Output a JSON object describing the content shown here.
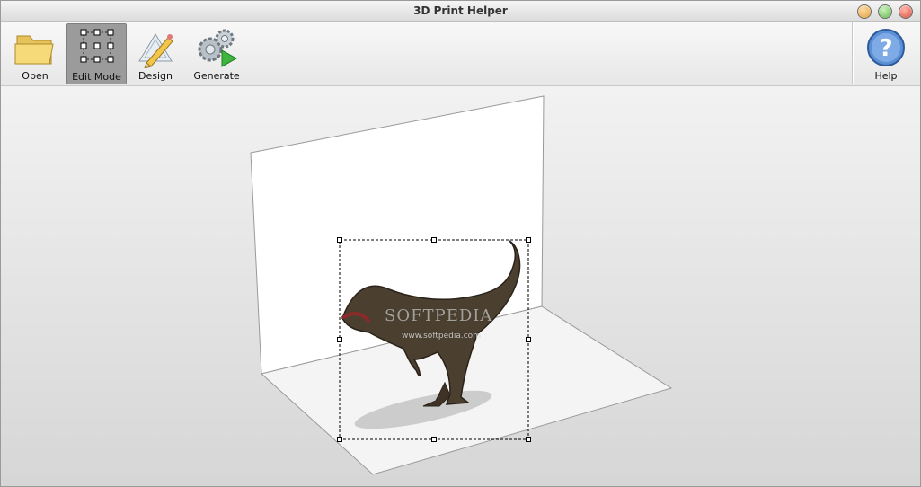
{
  "window": {
    "title": "3D Print Helper",
    "controls": [
      "minimize",
      "maximize",
      "close"
    ]
  },
  "toolbar": {
    "open_label": "Open",
    "edit_mode_label": "Edit Mode",
    "design_label": "Design",
    "generate_label": "Generate",
    "help_label": "Help",
    "active_tool": "Edit Mode"
  },
  "canvas": {
    "watermark": "SOFTPEDIA",
    "watermark_url": "www.softpedia.com",
    "object": "dinosaur-model"
  },
  "colors": {
    "selected_tool_bg": "#9b9b9b",
    "close": "#d74b3a",
    "maximize": "#5fb84e",
    "minimize": "#e0a03a"
  }
}
